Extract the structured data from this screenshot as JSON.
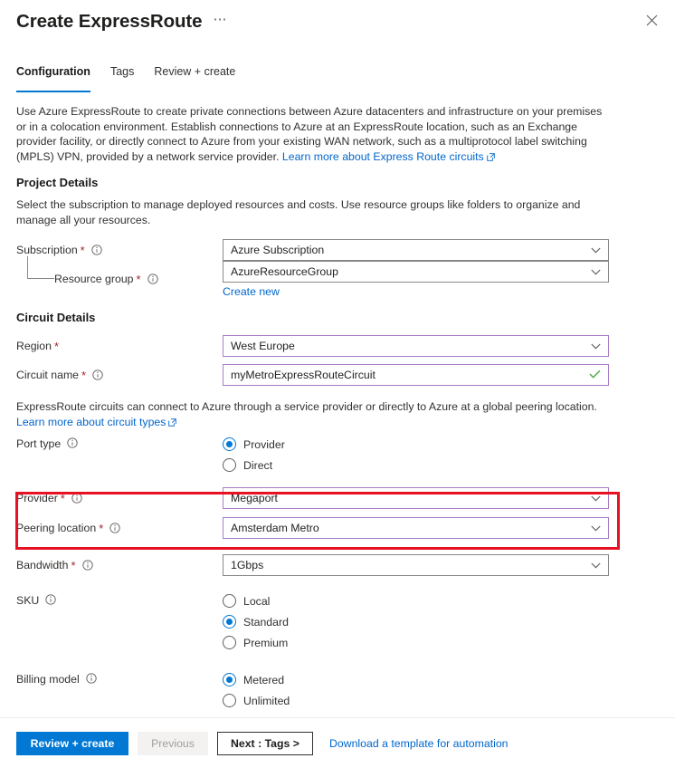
{
  "header": {
    "title": "Create ExpressRoute",
    "more_label": "⋯",
    "close_label": "close-icon"
  },
  "tabs": [
    {
      "label": "Configuration",
      "active": true
    },
    {
      "label": "Tags",
      "active": false
    },
    {
      "label": "Review + create",
      "active": false
    }
  ],
  "description": {
    "text": "Use Azure ExpressRoute to create private connections between Azure datacenters and infrastructure on your premises or in a colocation environment. Establish connections to Azure at an ExpressRoute location, such as an Exchange provider facility, or directly connect to Azure from your existing WAN network, such as a multiprotocol label switching (MPLS) VPN, provided by a network service provider. ",
    "link_label": "Learn more about Express Route circuits"
  },
  "project_details": {
    "section_title": "Project Details",
    "helper": "Select the subscription to manage deployed resources and costs. Use resource groups like folders to organize and manage all your resources.",
    "subscription": {
      "label": "Subscription",
      "required": "*",
      "value": "Azure Subscription"
    },
    "resource_group": {
      "label": "Resource group",
      "required": "*",
      "value": "AzureResourceGroup",
      "create_new_label": "Create new"
    }
  },
  "circuit_details": {
    "section_title": "Circuit Details",
    "region": {
      "label": "Region",
      "required": "*",
      "value": "West Europe"
    },
    "circuit_name": {
      "label": "Circuit name",
      "required": "*",
      "value": "myMetroExpressRouteCircuit"
    },
    "circuit_type_note": "ExpressRoute circuits can connect to Azure through a service provider or directly to Azure at a global peering location.",
    "circuit_type_link": "Learn more about circuit types",
    "port_type": {
      "label": "Port type",
      "options": [
        {
          "label": "Provider",
          "selected": true
        },
        {
          "label": "Direct",
          "selected": false
        }
      ]
    },
    "provider": {
      "label": "Provider",
      "required": "*",
      "value": "Megaport"
    },
    "peering_location": {
      "label": "Peering location",
      "required": "*",
      "value": "Amsterdam Metro"
    },
    "bandwidth": {
      "label": "Bandwidth",
      "required": "*",
      "value": "1Gbps"
    },
    "sku": {
      "label": "SKU",
      "options": [
        {
          "label": "Local",
          "selected": false
        },
        {
          "label": "Standard",
          "selected": true
        },
        {
          "label": "Premium",
          "selected": false
        }
      ]
    },
    "billing_model": {
      "label": "Billing model",
      "options": [
        {
          "label": "Metered",
          "selected": true
        },
        {
          "label": "Unlimited",
          "selected": false
        }
      ]
    }
  },
  "footer": {
    "review_create": "Review + create",
    "previous": "Previous",
    "next": "Next : Tags >",
    "download_template": "Download a template for automation"
  },
  "colors": {
    "accent": "#0078d4",
    "link": "#0066cc",
    "required": "#a4262c",
    "annotation": "#e81123",
    "modified_border": "#a97cc4",
    "valid_check": "#107c10"
  }
}
